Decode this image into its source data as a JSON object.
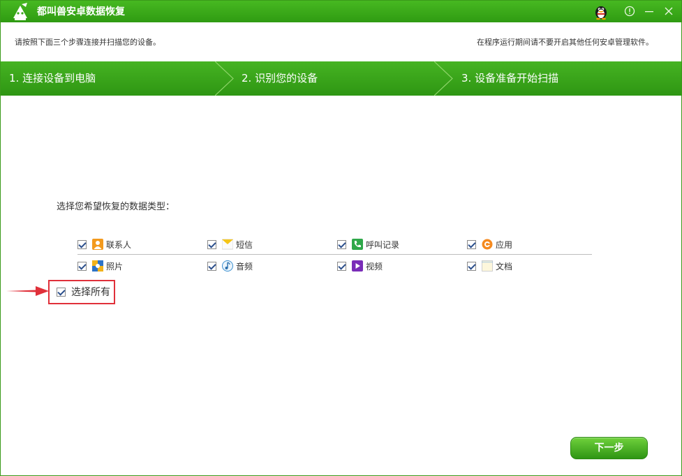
{
  "window": {
    "title": "都叫兽安卓数据恢复",
    "accent_color": "#3aa81b"
  },
  "header": {
    "hint_left": "请按照下面三个步骤连接并扫描您的设备。",
    "hint_right": "在程序运行期间请不要开启其他任何安卓管理软件。"
  },
  "steps": [
    {
      "label": "1. 连接设备到电脑"
    },
    {
      "label": "2. 识别您的设备"
    },
    {
      "label": "3. 设备准备开始扫描"
    }
  ],
  "main": {
    "prompt": "选择您希望恢复的数据类型：",
    "data_types": [
      {
        "label": "联系人",
        "icon": "contacts-icon",
        "checked": true
      },
      {
        "label": "短信",
        "icon": "message-icon",
        "checked": true
      },
      {
        "label": "呼叫记录",
        "icon": "call-log-icon",
        "checked": true
      },
      {
        "label": "应用",
        "icon": "app-icon",
        "checked": true
      },
      {
        "label": "照片",
        "icon": "photo-icon",
        "checked": true
      },
      {
        "label": "音频",
        "icon": "audio-icon",
        "checked": true
      },
      {
        "label": "视频",
        "icon": "video-icon",
        "checked": true
      },
      {
        "label": "文档",
        "icon": "document-icon",
        "checked": true
      }
    ],
    "select_all": {
      "label": "选择所有",
      "checked": true
    },
    "highlight_color": "#e0303a"
  },
  "footer": {
    "next_label": "下一步"
  }
}
